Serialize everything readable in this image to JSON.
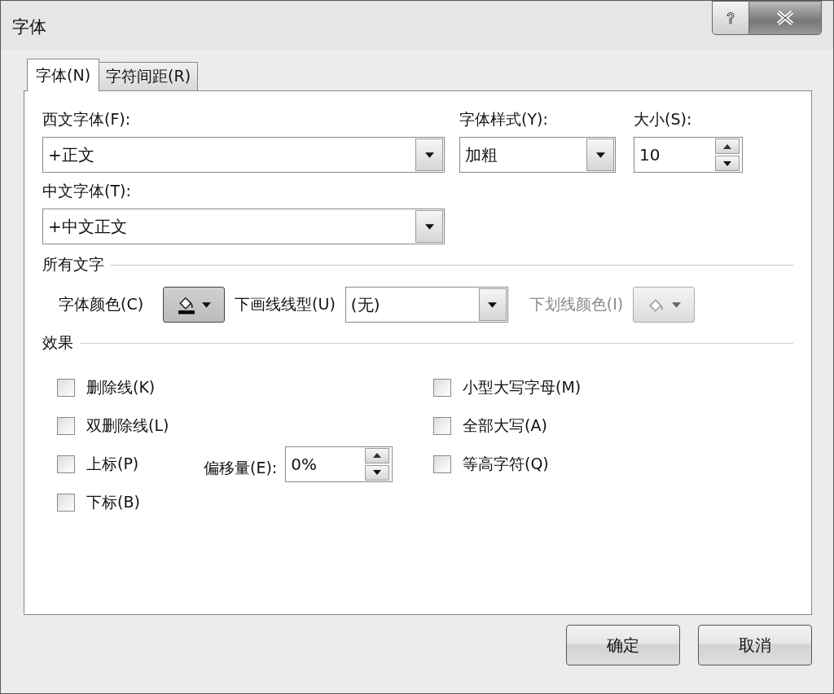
{
  "window": {
    "title": "字体"
  },
  "tabs": [
    {
      "label": "字体(N)",
      "selected": true
    },
    {
      "label": "字符间距(R)",
      "selected": false
    }
  ],
  "latin_font": {
    "label": "西文字体(F):",
    "value": "+正文"
  },
  "font_style": {
    "label": "字体样式(Y):",
    "value": "加粗"
  },
  "font_size": {
    "label": "大小(S):",
    "value": "10"
  },
  "asian_font": {
    "label": "中文字体(T):",
    "value": "+中文正文"
  },
  "all_text": {
    "heading": "所有文字",
    "font_color_label": "字体颜色(C)",
    "underline_style": {
      "label": "下画线线型(U)",
      "value": "(无)"
    },
    "underline_color": {
      "label": "下划线颜色(I)",
      "disabled": true
    }
  },
  "effects": {
    "heading": "效果",
    "left": [
      {
        "label": "删除线(K)",
        "checked": false
      },
      {
        "label": "双删除线(L)",
        "checked": false
      },
      {
        "label": "上标(P)",
        "checked": false
      },
      {
        "label": "下标(B)",
        "checked": false
      }
    ],
    "right": [
      {
        "label": "小型大写字母(M)",
        "checked": false
      },
      {
        "label": "全部大写(A)",
        "checked": false
      },
      {
        "label": "等高字符(Q)",
        "checked": false
      }
    ],
    "offset": {
      "label": "偏移量(E):",
      "value": "0%"
    }
  },
  "buttons": [
    "确定",
    "取消"
  ]
}
